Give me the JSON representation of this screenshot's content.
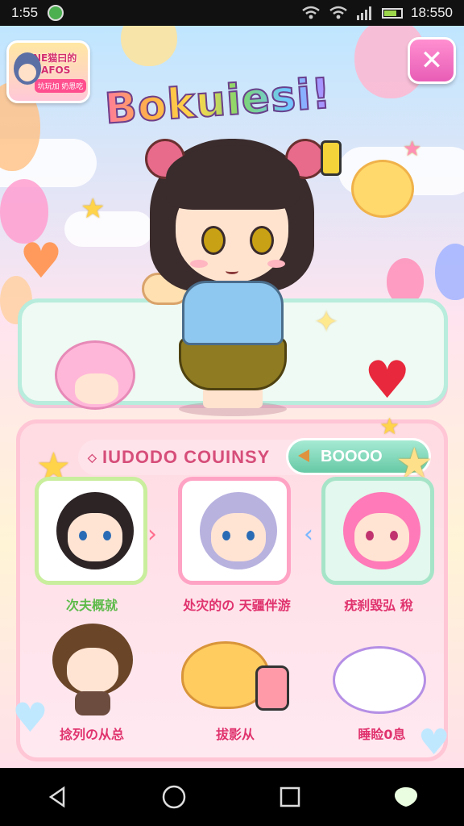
{
  "status_bar": {
    "time_left": "1:55",
    "time_right": "18:5⁠50",
    "icons": [
      "app-icon",
      "wifi-icon",
      "wifi-icon",
      "signal-icon",
      "battery-icon"
    ]
  },
  "header": {
    "logo_line1": "NE猫曰的 HAFOS",
    "logo_line2": "坑玩加 奶恩吃",
    "title": "Bokuiesi!",
    "close_label": "✕"
  },
  "list_panel": {
    "header_label": "IUDODO COUINSY",
    "tag_label": "BOOOO",
    "characters": [
      {
        "label": "次夫概就",
        "label_color": "#5dbb4a",
        "hair": "#2d2426",
        "accent": "#f6b5e0",
        "border": "#c9ee9d"
      },
      {
        "label": "处灾的の 天疆伴游",
        "label_color": "#e0336e",
        "hair": "#b8b2df",
        "accent": "#c2396a",
        "border": "#ffa3c4"
      },
      {
        "label": "疣刹毀弘 稅",
        "label_color": "#e0336e",
        "hair": "#ff7ab8",
        "accent": "#4a5fa8",
        "border": "#a6e4c8"
      },
      {
        "label": "捻列の从总",
        "label_color": "#e0336e",
        "hair": "#6b4528",
        "accent": "#6b4c3e",
        "border": "none"
      },
      {
        "label": "拔影从",
        "label_color": "#e0336e",
        "hair": "#ffcc5f",
        "accent": "#ff9aa8",
        "border": "none"
      },
      {
        "label": "睡睑0息",
        "label_color": "#e0336e",
        "hair": "#ffffff",
        "accent": "#b58fe5",
        "border": "none"
      }
    ]
  },
  "nav": {
    "icons": [
      "back-icon",
      "home-icon",
      "recents-icon",
      "assistant-icon"
    ]
  },
  "colors": {
    "brand_pink": "#ff4f8e",
    "panel_mint": "#b8ecdc",
    "panel_pink": "#ffc6d6"
  }
}
